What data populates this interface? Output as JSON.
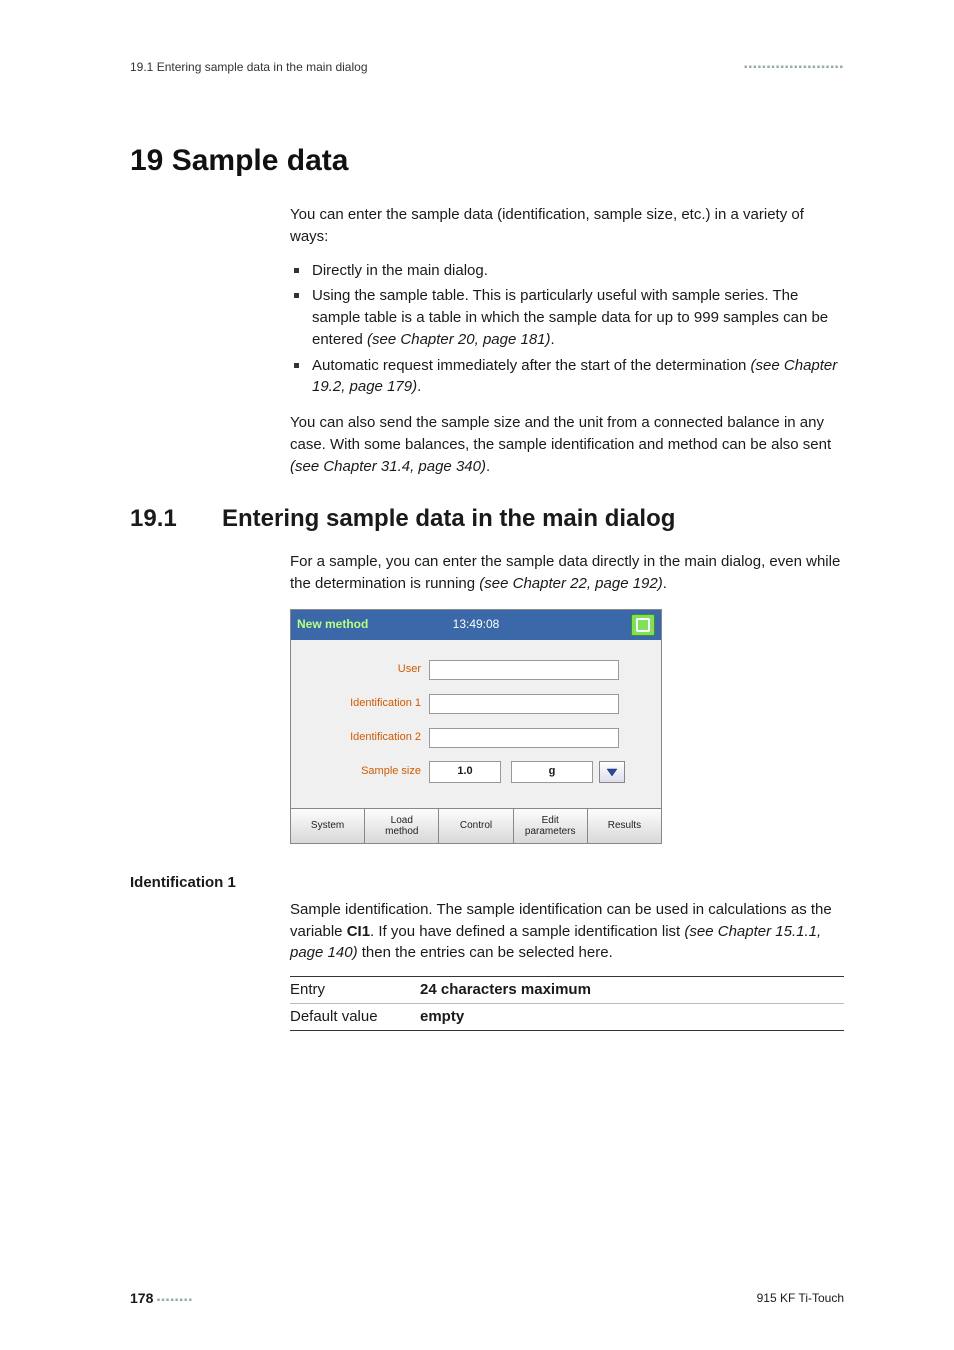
{
  "header": {
    "left": "19.1 Entering sample data in the main dialog",
    "dashes_long": "▪▪▪▪▪▪▪▪▪▪▪▪▪▪▪▪▪▪▪▪▪▪",
    "dashes_short": "▪▪▪▪▪▪▪▪"
  },
  "chapter_title": "19 Sample data",
  "intro": "You can enter the sample data (identification, sample size, etc.) in a variety of ways:",
  "bullets": {
    "b1": "Directly in the main dialog.",
    "b2a": "Using the sample table. This is particularly useful with sample series. The sample table is a table in which the sample data for up to 999 samples can be entered ",
    "b2b": "(see Chapter 20, page 181)",
    "b2c": ".",
    "b3a": "Automatic request immediately after the start of the determination ",
    "b3b": "(see Chapter 19.2, page 179)",
    "b3c": "."
  },
  "post_bullets_a": "You can also send the sample size and the unit from a connected balance in any case. With some balances, the sample identification and method can be also sent ",
  "post_bullets_b": "(see Chapter 31.4, page 340)",
  "post_bullets_c": ".",
  "section": {
    "num": "19.1",
    "title": "Entering sample data in the main dialog",
    "lead_a": "For a sample, you can enter the sample data directly in the main dialog, even while the determination is running ",
    "lead_b": "(see Chapter 22, page 192)",
    "lead_c": "."
  },
  "device": {
    "title_left": "New method",
    "title_center": "13:49:08",
    "labels": {
      "user": "User",
      "id1": "Identification 1",
      "id2": "Identification 2",
      "size": "Sample size"
    },
    "size_value": "1.0",
    "size_unit": "g",
    "tabs": {
      "t1": "System",
      "t2": "Load\nmethod",
      "t3": "Control",
      "t4": "Edit\nparameters",
      "t5": "Results"
    }
  },
  "ident1": {
    "heading": "Identification 1",
    "para_a": "Sample identification. The sample identification can be used in calculations as the variable ",
    "var": "CI1",
    "para_b": ". If you have defined a sample identification list ",
    "para_c": "(see Chapter 15.1.1, page 140)",
    "para_d": " then the entries can be selected here.",
    "rows": {
      "entry_k": "Entry",
      "entry_v": "24 characters maximum",
      "default_k": "Default value",
      "default_v": "empty"
    }
  },
  "footer": {
    "page": "178",
    "product": "915 KF Ti-Touch"
  }
}
